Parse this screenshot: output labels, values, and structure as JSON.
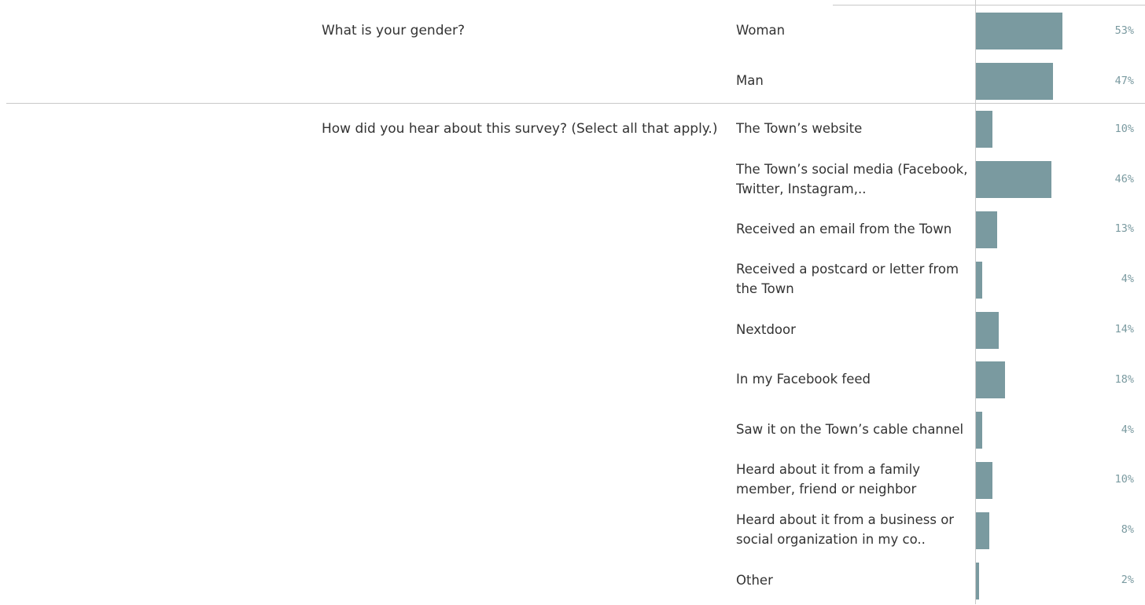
{
  "chart_data": {
    "type": "bar",
    "orientation": "horizontal",
    "bar_color": "#7a9aa0",
    "value_format": "percent",
    "groups": [
      {
        "question": "What is your gender?",
        "rows": [
          {
            "label": "Woman",
            "value": 53,
            "display": "53%"
          },
          {
            "label": "Man",
            "value": 47,
            "display": "47%"
          }
        ]
      },
      {
        "question": "How did you hear about this survey? (Select all that apply.)",
        "rows": [
          {
            "label": "The Town’s website",
            "value": 10,
            "display": "10%"
          },
          {
            "label": "The Town’s social media (Facebook, Twitter, Instagram,..",
            "value": 46,
            "display": "46%"
          },
          {
            "label": "Received an email from the Town",
            "value": 13,
            "display": "13%"
          },
          {
            "label": "Received a postcard or letter from the Town",
            "value": 4,
            "display": "4%"
          },
          {
            "label": "Nextdoor",
            "value": 14,
            "display": "14%"
          },
          {
            "label": "In my Facebook feed",
            "value": 18,
            "display": "18%"
          },
          {
            "label": "Saw it on the Town’s cable channel",
            "value": 4,
            "display": "4%"
          },
          {
            "label": "Heard about it from a family member, friend or neighbor",
            "value": 10,
            "display": "10%"
          },
          {
            "label": "Heard about it from a business or social organization in my co..",
            "value": 8,
            "display": "8%"
          },
          {
            "label": "Other",
            "value": 2,
            "display": "2%"
          }
        ]
      }
    ]
  }
}
